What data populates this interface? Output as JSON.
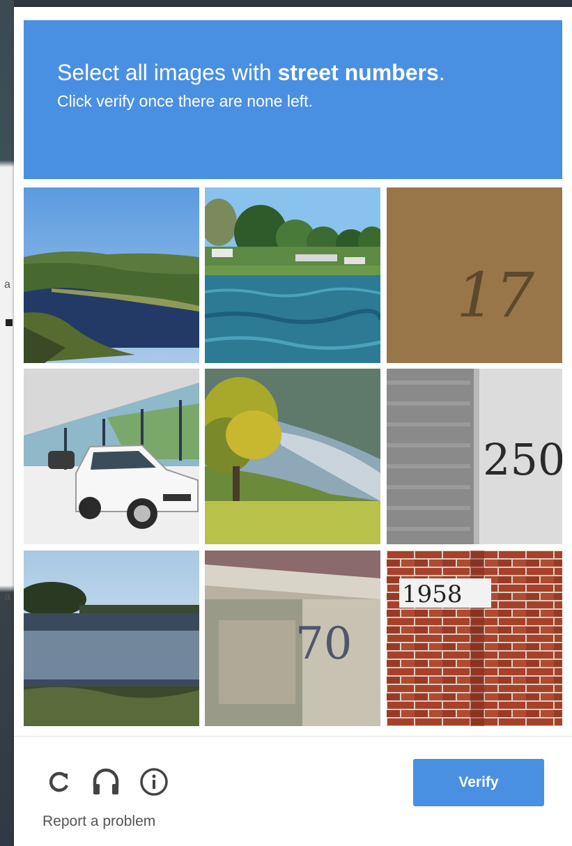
{
  "header": {
    "instruction_prefix": "Select all images with ",
    "target": "street numbers",
    "instruction_suffix": ".",
    "subtext": "Click verify once there are none left."
  },
  "tiles": [
    {
      "content": "lake-valley"
    },
    {
      "content": "lakeshore-water"
    },
    {
      "content": "street-number",
      "number": "17"
    },
    {
      "content": "car-showroom"
    },
    {
      "content": "tree-lake"
    },
    {
      "content": "street-number",
      "number": "250"
    },
    {
      "content": "lake-reflection"
    },
    {
      "content": "street-number",
      "number": "70"
    },
    {
      "content": "street-number",
      "number": "1958"
    }
  ],
  "footer": {
    "reload_icon": "reload-icon",
    "audio_icon": "headphones-icon",
    "info_icon": "info-icon",
    "report_label": "Report a problem",
    "verify_label": "Verify"
  },
  "colors": {
    "accent": "#4a90e2",
    "header_text": "#ffffff",
    "icon": "#444444"
  }
}
